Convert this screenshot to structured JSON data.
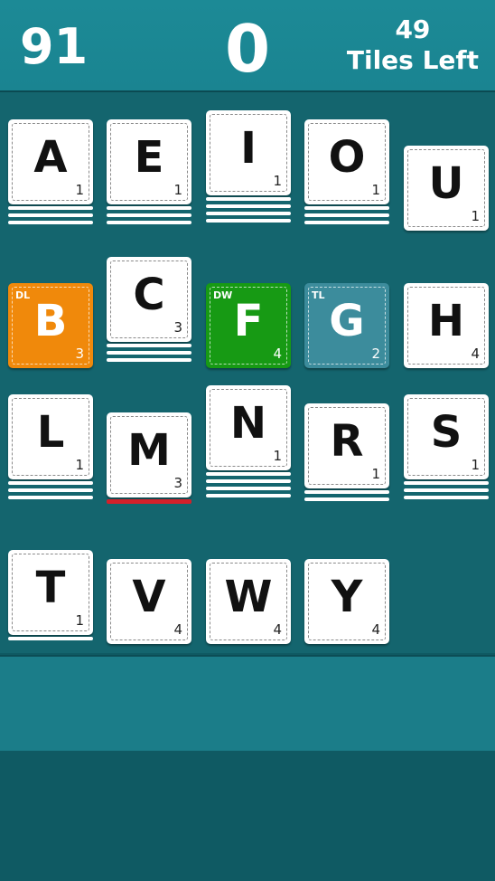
{
  "header": {
    "left_score": "91",
    "center_score": "0",
    "tiles_left_count": "49",
    "tiles_left_label": "Tiles Left"
  },
  "tiles": [
    {
      "letter": "A",
      "points": "1",
      "bonus": "",
      "stack": 3
    },
    {
      "letter": "E",
      "points": "1",
      "bonus": "",
      "stack": 3
    },
    {
      "letter": "I",
      "points": "1",
      "bonus": "",
      "stack": 3
    },
    {
      "letter": "O",
      "points": "1",
      "bonus": "",
      "stack": 3
    },
    {
      "letter": "U",
      "points": "1",
      "bonus": "",
      "stack": 0
    },
    {
      "letter": "B",
      "points": "3",
      "bonus": "DL",
      "stack": 0
    },
    {
      "letter": "C",
      "points": "3",
      "bonus": "",
      "stack": 3
    },
    {
      "letter": "F",
      "points": "4",
      "bonus": "DW",
      "stack": 0
    },
    {
      "letter": "G",
      "points": "2",
      "bonus": "TL",
      "stack": 0
    },
    {
      "letter": "H",
      "points": "4",
      "bonus": "",
      "stack": 0
    },
    {
      "letter": "L",
      "points": "1",
      "bonus": "",
      "stack": 3
    },
    {
      "letter": "M",
      "points": "3",
      "bonus": "",
      "stack": 1,
      "red": true
    },
    {
      "letter": "N",
      "points": "1",
      "bonus": "",
      "stack": 3
    },
    {
      "letter": "R",
      "points": "1",
      "bonus": "",
      "stack": 2
    },
    {
      "letter": "S",
      "points": "1",
      "bonus": "",
      "stack": 3
    },
    {
      "letter": "T",
      "points": "1",
      "bonus": "",
      "stack": 1
    },
    {
      "letter": "V",
      "points": "4",
      "bonus": "",
      "stack": 0
    },
    {
      "letter": "W",
      "points": "4",
      "bonus": "",
      "stack": 0
    },
    {
      "letter": "Y",
      "points": "4",
      "bonus": "",
      "stack": 0
    }
  ],
  "colors": {
    "header": "#1c8a96",
    "board": "#14656e",
    "double_letter": "#f0890b",
    "double_word": "#179a14",
    "triple_letter": "#3c8c9c",
    "selected_underline": "#d4202a"
  }
}
